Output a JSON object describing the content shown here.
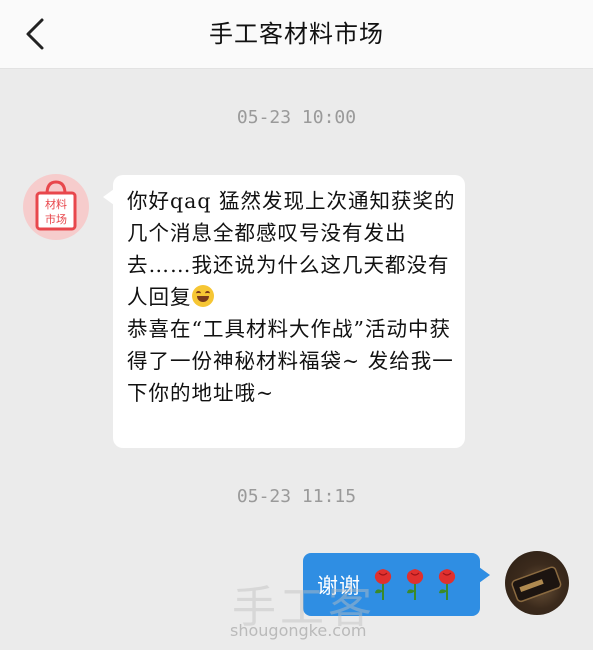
{
  "header": {
    "title": "手工客材料市场",
    "back_icon": "chevron-left-icon"
  },
  "messages": [
    {
      "time": "05-23 10:00",
      "sender": "shop",
      "avatar_text": "材料\n市场",
      "avatar_icon": "shopping-bag-icon",
      "text_part1": "你好qaq 猛然发现上次通知获奖的几个消息全都感叹号没有发出去……我还说为什么这几天都没有人回复",
      "emoji": "laughing-emoji-icon",
      "text_part2": "\n恭喜在“工具材料大作战”活动中获得了一份神秘材料福袋~ 发给我一下你的地址哦~"
    },
    {
      "time": "05-23 11:15",
      "sender": "me",
      "text": "谢谢",
      "emojis": [
        "rose-icon",
        "rose-icon",
        "rose-icon"
      ]
    }
  ],
  "watermark": {
    "logo_text": "手工客",
    "url": "shougongke.com"
  },
  "colors": {
    "bubble_me": "#2f8ee3",
    "background": "#ebebeb",
    "shop_avatar_bg": "#f6cccc",
    "shop_accent": "#e8474c"
  }
}
